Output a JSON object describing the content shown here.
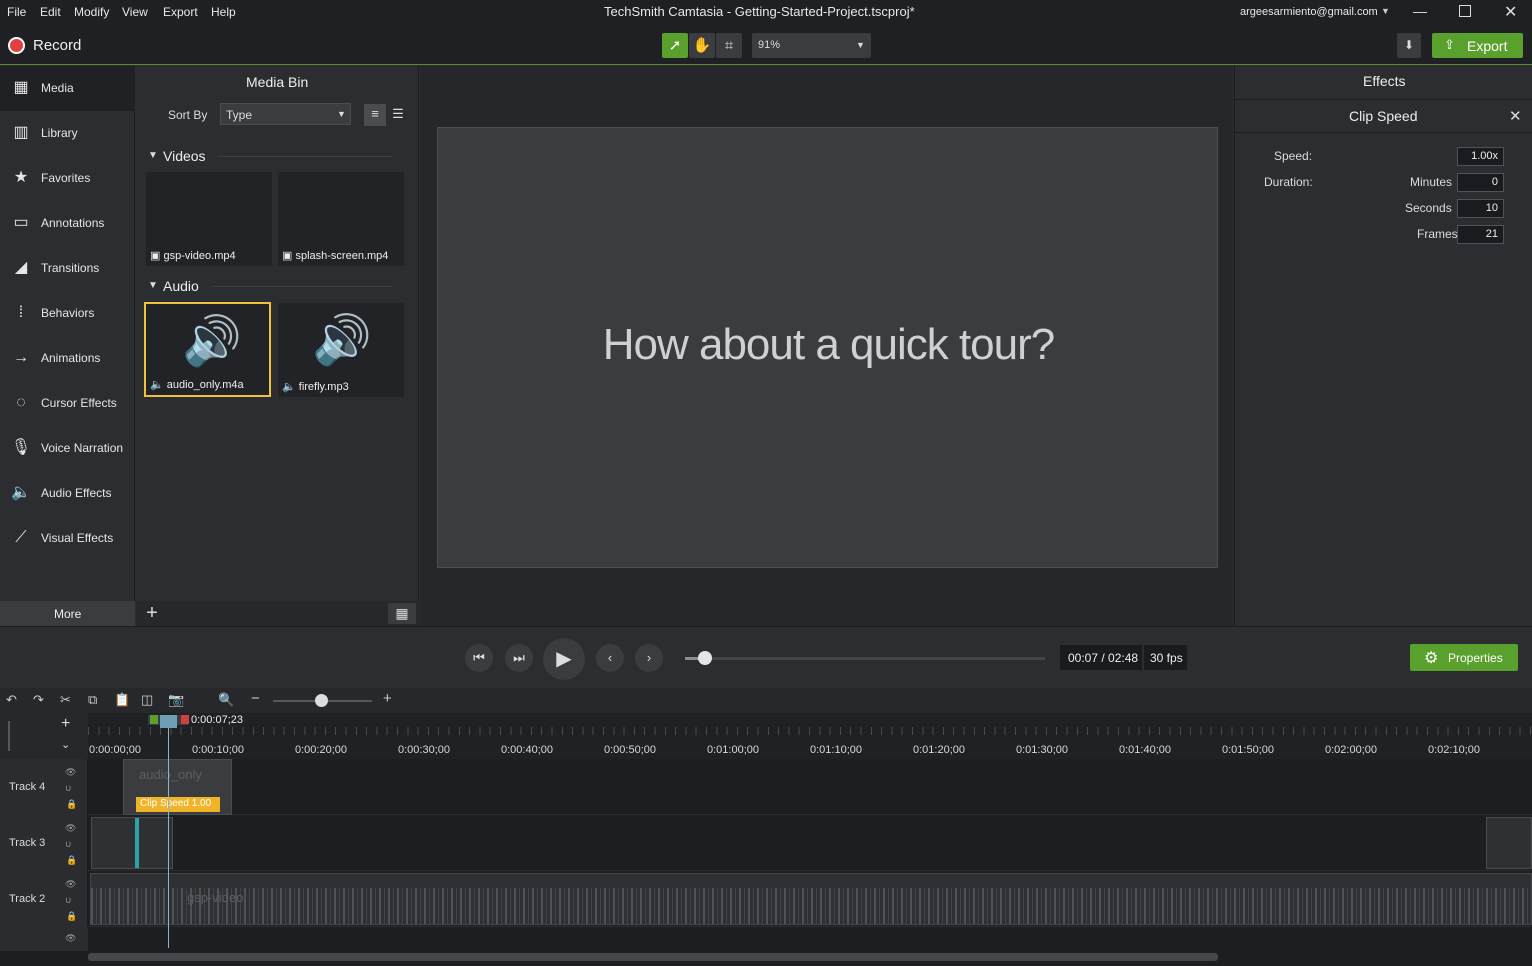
{
  "menu": {
    "items": [
      "File",
      "Edit",
      "Modify",
      "View",
      "Export",
      "Help"
    ]
  },
  "title": "TechSmith Camtasia - Getting-Started-Project.tscproj*",
  "account": "argeesarmiento@gmail.com",
  "toolbar": {
    "record_label": "Record",
    "zoom_value": "91%",
    "export_label": "Export"
  },
  "nav": {
    "items": [
      {
        "label": "Media",
        "icon": "media-icon"
      },
      {
        "label": "Library",
        "icon": "library-icon"
      },
      {
        "label": "Favorites",
        "icon": "star-icon"
      },
      {
        "label": "Annotations",
        "icon": "annotations-icon"
      },
      {
        "label": "Transitions",
        "icon": "transitions-icon"
      },
      {
        "label": "Behaviors",
        "icon": "behaviors-icon"
      },
      {
        "label": "Animations",
        "icon": "animations-icon"
      },
      {
        "label": "Cursor Effects",
        "icon": "cursor-effects-icon"
      },
      {
        "label": "Voice Narration",
        "icon": "microphone-icon"
      },
      {
        "label": "Audio Effects",
        "icon": "speaker-icon"
      },
      {
        "label": "Visual Effects",
        "icon": "wand-icon"
      }
    ],
    "more_label": "More"
  },
  "mediabin": {
    "title": "Media Bin",
    "sort_by_label": "Sort By",
    "sort_value": "Type",
    "videos_label": "Videos",
    "audio_label": "Audio",
    "videos": [
      "gsp-video.mp4",
      "splash-screen.mp4"
    ],
    "audio": [
      "audio_only.m4a",
      "firefly.mp3"
    ]
  },
  "canvas": {
    "text": "How about a quick tour?"
  },
  "effects": {
    "panel_title": "Effects",
    "effect_title": "Clip Speed",
    "speed_label": "Speed:",
    "speed_value": "1.00x",
    "duration_label": "Duration:",
    "minutes_label": "Minutes",
    "minutes_value": "0",
    "seconds_label": "Seconds",
    "seconds_value": "10",
    "frames_label": "Frames",
    "frames_value": "21"
  },
  "playback": {
    "time": "00:07 / 02:48",
    "fps": "30 fps",
    "properties_label": "Properties",
    "progress": 0.042
  },
  "timeline": {
    "playhead_time": "0:00:07;23",
    "ruler": [
      "0:00:00;00",
      "0:00:10;00",
      "0:00:20;00",
      "0:00:30;00",
      "0:00:40;00",
      "0:00:50;00",
      "0:01:00;00",
      "0:01:10;00",
      "0:01:20;00",
      "0:01:30;00",
      "0:01:40;00",
      "0:01:50;00",
      "0:02:00;00",
      "0:02:10;00"
    ],
    "tracks": [
      "Track 4",
      "Track 3",
      "Track 2"
    ],
    "clip_audio_only": "audio_only",
    "clip_speed_tag": "Clip Speed 1.00",
    "clip_gsp": "gsp-video"
  }
}
